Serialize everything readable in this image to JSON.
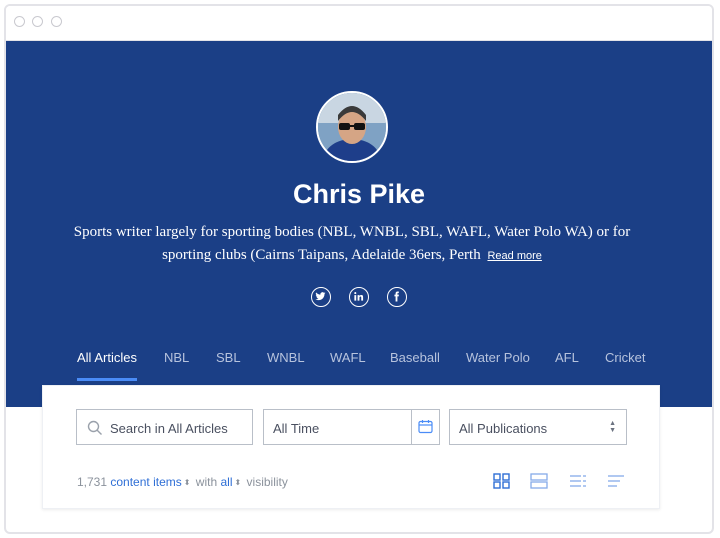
{
  "window": {
    "controls": [
      "close",
      "minimize",
      "maximize"
    ]
  },
  "profile": {
    "name": "Chris Pike",
    "bio": "Sports writer largely for sporting bodies (NBL, WNBL, SBL, WAFL, Water Polo WA) or for sporting clubs (Cairns Taipans, Adelaide 36ers, Perth",
    "read_more": "Read more",
    "socials": [
      "twitter-icon",
      "linkedin-icon",
      "facebook-icon"
    ]
  },
  "tabs": [
    {
      "label": "All Articles",
      "active": true
    },
    {
      "label": "NBL"
    },
    {
      "label": "SBL"
    },
    {
      "label": "WNBL"
    },
    {
      "label": "WAFL"
    },
    {
      "label": "Baseball"
    },
    {
      "label": "Water Polo"
    },
    {
      "label": "AFL"
    },
    {
      "label": "Cricket"
    }
  ],
  "filters": {
    "search_placeholder": "Search in All Articles",
    "time_value": "All Time",
    "publication_value": "All Publications"
  },
  "summary": {
    "count": "1,731",
    "items_label": "content items",
    "with_label": "with",
    "visibility_value": "all",
    "visibility_label": "visibility"
  },
  "colors": {
    "hero": "#1b3f86",
    "accent": "#2f6fd6",
    "tab_indicator": "#4a8cf7"
  }
}
